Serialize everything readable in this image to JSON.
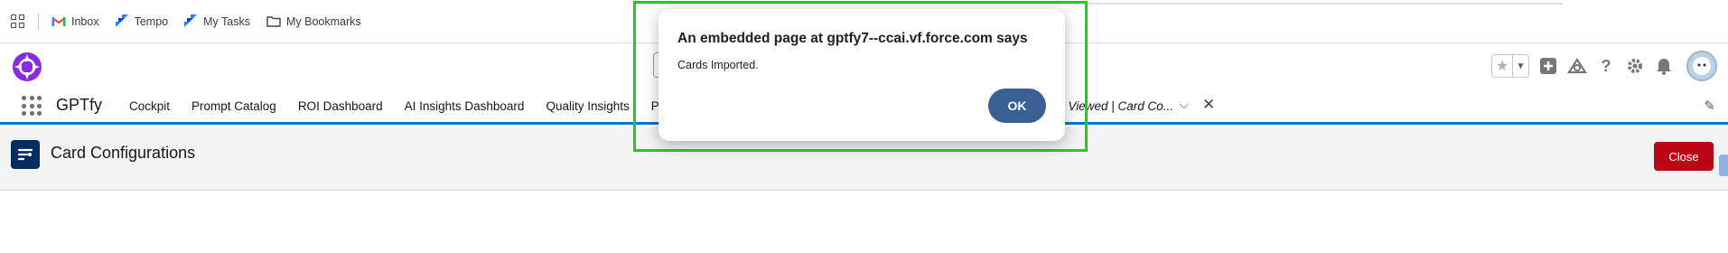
{
  "bookmarks": {
    "items": [
      {
        "label": "Inbox",
        "icon": "gmail-icon"
      },
      {
        "label": "Tempo",
        "icon": "tempo-icon"
      },
      {
        "label": "My Tasks",
        "icon": "jira-icon"
      },
      {
        "label": "My Bookmarks",
        "icon": "folder-icon"
      }
    ]
  },
  "app": {
    "name": "GPTfy",
    "tabs": [
      "Cockpit",
      "Prompt Catalog",
      "ROI Dashboard",
      "AI Insights Dashboard",
      "Quality Insights",
      "Prom"
    ],
    "recent_tab": "y Viewed | Card Co..."
  },
  "page": {
    "title": "Card Configurations",
    "close_label": "Close"
  },
  "dialog": {
    "title": "An embedded page at gptfy7--ccai.vf.force.com says",
    "message": "Cards Imported.",
    "ok_label": "OK"
  },
  "colors": {
    "brand_blue": "#0176d3",
    "close_red": "#ba0517",
    "ok_blue": "#3a5f95",
    "highlight_green": "#1ed10f"
  }
}
